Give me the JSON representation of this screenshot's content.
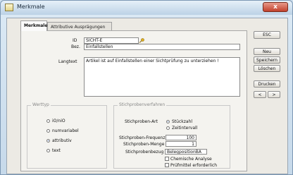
{
  "window": {
    "title": "Merkmale",
    "close_label": "x"
  },
  "tabs": [
    {
      "label": "Merkmale"
    },
    {
      "label": "Attributive Ausprägungen"
    }
  ],
  "form": {
    "id_label": "ID",
    "id_value": "SICHT-E",
    "bez_label": "Bez.",
    "bez_value": "Einfallstellen",
    "langtext_label": "Langtext",
    "langtext_value": "Artikel ist auf Einfallstellen einer Sichtprüfung zu unterziehen !"
  },
  "werttyp": {
    "title": "Werttyp",
    "options": [
      "iO/niO",
      "numvariabel",
      "attributiv",
      "text"
    ],
    "selected": "attributiv"
  },
  "stichprobe": {
    "title": "Stichprobenverfahren",
    "art_label": "Stichproben-Art",
    "art_options": [
      "Stückzahl",
      "Zeitintervall"
    ],
    "art_selected": "Stückzahl",
    "frequenz_label": "Stichproben-Frequenz",
    "frequenz_value": "100",
    "menge_label": "Stichproben-Menge",
    "menge_value": "1",
    "bezug_label": "Stichprobenbezug",
    "bezug_value": "BelegpositionBA",
    "checks": [
      {
        "label": "Chemische Analyse",
        "checked": false
      },
      {
        "label": "Prüfmittel erforderlich",
        "checked": false
      }
    ]
  },
  "buttons": {
    "esc": "ESC",
    "neu": "Neu",
    "speichern": "Speichern",
    "loeschen": "Löschen",
    "drucken": "Drucken",
    "prev": "<",
    "next": ">"
  }
}
